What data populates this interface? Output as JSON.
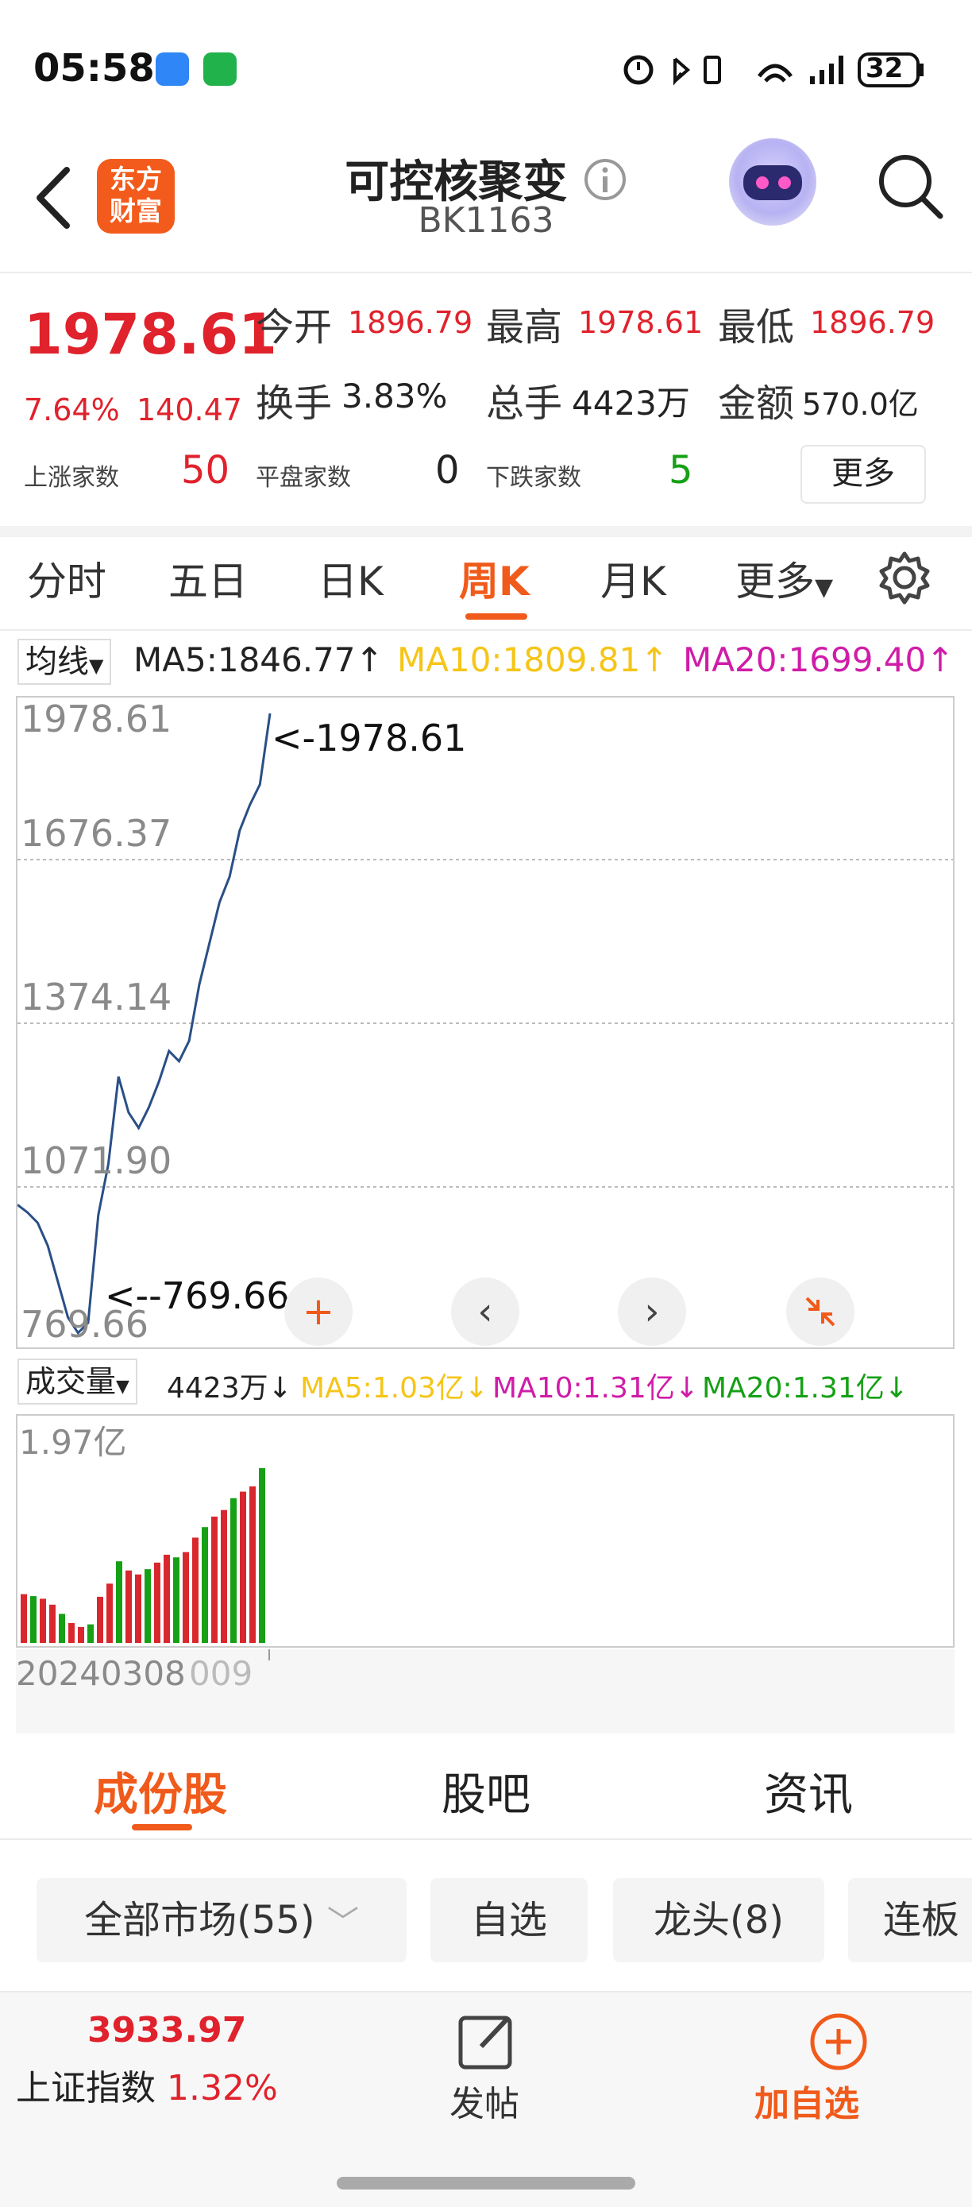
{
  "status_bar": {
    "time": "05:58",
    "battery": "32"
  },
  "header": {
    "title": "可控核聚变",
    "code": "BK1163",
    "logo_line1": "东方",
    "logo_line2": "财富"
  },
  "quote": {
    "price": "1978.61",
    "change_pct": "7.64%",
    "change": "140.47",
    "open_label": "今开",
    "open": "1896.79",
    "high_label": "最高",
    "high": "1978.61",
    "low_label": "最低",
    "low": "1896.79",
    "turnover_label": "换手",
    "turnover": "3.83%",
    "volume_label": "总手",
    "volume": "4423万",
    "amount_label": "金额",
    "amount": "570.0亿",
    "up_label": "上涨家数",
    "up_count": "50",
    "flat_label": "平盘家数",
    "flat_count": "0",
    "down_label": "下跌家数",
    "down_count": "5",
    "more": "更多"
  },
  "tabs": [
    "分时",
    "五日",
    "日K",
    "周K",
    "月K",
    "更多"
  ],
  "ma": {
    "selector": "均线",
    "ma5": "MA5:1846.77",
    "ma10": "MA10:1809.81",
    "ma20": "MA20:1699.40",
    "colors": {
      "ma5": "#222222",
      "ma10": "#f5c518",
      "ma20": "#d01ca8"
    }
  },
  "chart": {
    "y_labels": [
      "1978.61",
      "1676.37",
      "1374.14",
      "1071.90",
      "769.66"
    ],
    "max_marker": "<-1978.61",
    "min_marker": "<--769.66"
  },
  "volume": {
    "selector": "成交量",
    "vol": "4423万",
    "ma5": "MA5:1.03亿",
    "ma10": "MA10:1.31亿",
    "ma20": "MA20:1.31亿",
    "y_label": "1.97亿"
  },
  "dates": {
    "start": "20240308",
    "end": "009"
  },
  "bottom_tabs": [
    "成份股",
    "股吧",
    "资讯"
  ],
  "filters": [
    "全部市场(55)",
    "自选",
    "龙头(8)",
    "连板"
  ],
  "footer": {
    "index_value": "3933.97",
    "index_name": "上证指数",
    "index_change": "1.32%",
    "post": "发帖",
    "add": "加自选"
  },
  "chart_data": {
    "type": "line",
    "ylim": [
      769.66,
      1978.61
    ],
    "values": [
      1020,
      1005,
      985,
      940,
      870,
      800,
      770,
      790,
      1000,
      1100,
      1270,
      1200,
      1170,
      1210,
      1260,
      1320,
      1300,
      1340,
      1450,
      1530,
      1610,
      1660,
      1750,
      1800,
      1840,
      1978.61
    ]
  }
}
